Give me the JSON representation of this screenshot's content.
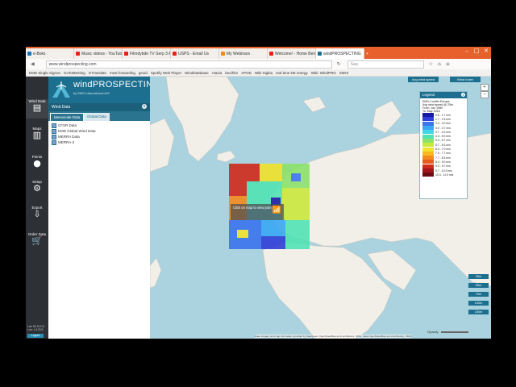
{
  "browser": {
    "tabs": [
      {
        "label": "e-Boks",
        "color": "#1b6fb5"
      },
      {
        "label": "Music videos - YouTube",
        "color": "#e62117"
      },
      {
        "label": "Filmdybde TV Serp 3 Af...",
        "color": "#e62117"
      },
      {
        "label": "USPS - Email Us",
        "color": "#e62117"
      },
      {
        "label": "My Webinars",
        "color": "#f08a24"
      },
      {
        "label": "Welcome! - Home Bench",
        "color": "#e62117"
      },
      {
        "label": "windPROSPECTING",
        "color": "#1d6f8f"
      }
    ],
    "new_tab": "+",
    "window_controls": {
      "minimize": "–",
      "maximize": "□",
      "close": "✕"
    },
    "url": "www.windprospecting.com",
    "search_placeholder": "Søg",
    "bookmarks": [
      "EMD Single Signon",
      "GoToMeeting",
      "GTranslate",
      "mest forwarding",
      "geoid",
      "Spotify Web Player",
      "WindDatabase",
      "Ataxia",
      "beo/hkn",
      "APOD",
      "Wiki Sigkia",
      "real time DE energy",
      "Wiki: WindPRO",
      "SMHI"
    ]
  },
  "iconbar": {
    "items": [
      {
        "label": "Wind Data",
        "icon": "▤"
      },
      {
        "label": "Maps",
        "icon": "▥"
      },
      {
        "label": "Points",
        "icon": "●"
      },
      {
        "label": "Setup",
        "icon": "⚙"
      },
      {
        "label": "Export",
        "icon": "⇩"
      },
      {
        "label": "Order Data",
        "icon": "🛒"
      }
    ],
    "lat": "Lat: 50.312 N",
    "lon": "Lon: 4.123 E",
    "logout": "Logout"
  },
  "panel": {
    "brand_title": "windPROSPECTING",
    "brand_sub": "by EMD International A/S",
    "header": "Wind Data",
    "close": "x",
    "tab_mesoscale": "Mesoscale Data",
    "tab_global": "Global Data",
    "datasets": [
      "CFSR Data",
      "EMD Global Wind Data",
      "MERRA Data",
      "MERRA-2"
    ]
  },
  "map": {
    "btn_avg_wind": "Avg wind speed",
    "btn_wind_index": "Wind Index",
    "zoom_in": "+",
    "zoom_out": "−",
    "tooltip": "Click on map to view point data",
    "opacity_label": "Opacity",
    "attribution": "Data, imagery and map information provided by MapQuest, OpenStreetMap and contributors, ODbL, Data OpenStreetMap and contributors, ODbL"
  },
  "legend": {
    "title": "Legend",
    "close": "x",
    "dataset": "EMD-ConWx Europe",
    "measure": "Avg wind speed @ 25m",
    "from": "From:  Jan 1980",
    "to": "To:     May 2016",
    "entries": [
      {
        "range": "0.5 - 1.7 m/s",
        "color": "#1a1aa8"
      },
      {
        "range": "1.7 - 2.3 m/s",
        "color": "#2f3ed8"
      },
      {
        "range": "2.3 - 3.0 m/s",
        "color": "#3c74ee"
      },
      {
        "range": "3.0 - 3.7 m/s",
        "color": "#3aa8f2"
      },
      {
        "range": "3.7 - 4.3 m/s",
        "color": "#3ed7e8"
      },
      {
        "range": "4.3 - 5.0 m/s",
        "color": "#52e3b4"
      },
      {
        "range": "5.0 - 5.7 m/s",
        "color": "#8be26a"
      },
      {
        "range": "5.7 - 6.3 m/s",
        "color": "#c8e83c"
      },
      {
        "range": "6.3 - 7.0 m/s",
        "color": "#f2e22a"
      },
      {
        "range": "7.0 - 7.7 m/s",
        "color": "#f8b81e"
      },
      {
        "range": "7.7 - 8.3 m/s",
        "color": "#f48a1c"
      },
      {
        "range": "8.3 - 9.0 m/s",
        "color": "#ea5a1c"
      },
      {
        "range": "9.0 - 9.7 m/s",
        "color": "#cf2a1a"
      },
      {
        "range": "9.7 - 10.3 m/s",
        "color": "#a3141a"
      },
      {
        "range": "10.3 - 11.0 m/s",
        "color": "#6e0a12"
      }
    ]
  },
  "height_buttons": [
    "25m",
    "50m",
    "75m",
    "100m",
    "150m"
  ]
}
